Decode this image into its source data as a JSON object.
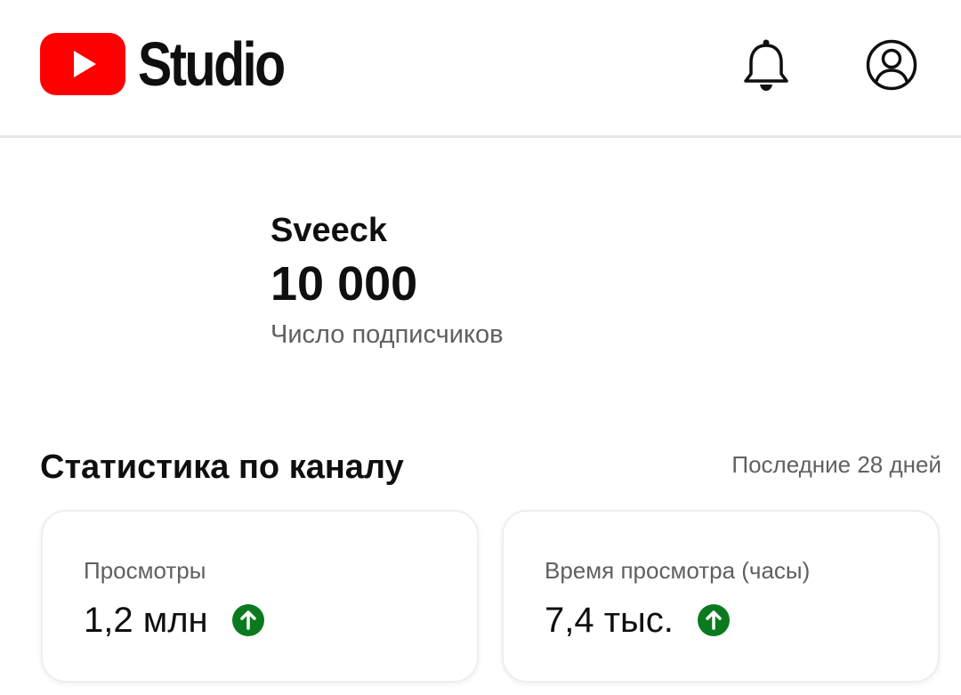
{
  "header": {
    "app_title": "Studio",
    "logo_icon": "youtube-play-logo",
    "bell_icon": "bell-icon",
    "account_icon": "account-circle-icon",
    "brand_color": "#ff0000"
  },
  "channel": {
    "name": "Sveeck",
    "subscriber_count": "10 000",
    "subscriber_label": "Число подписчиков"
  },
  "stats": {
    "title": "Статистика по каналу",
    "period": "Последние 28 дней",
    "trend_color": "#0b7a1e",
    "cards": [
      {
        "label": "Просмотры",
        "value": "1,2 млн",
        "trend": "up"
      },
      {
        "label": "Время просмотра (часы)",
        "value": "7,4 тыс.",
        "trend": "up"
      }
    ]
  }
}
